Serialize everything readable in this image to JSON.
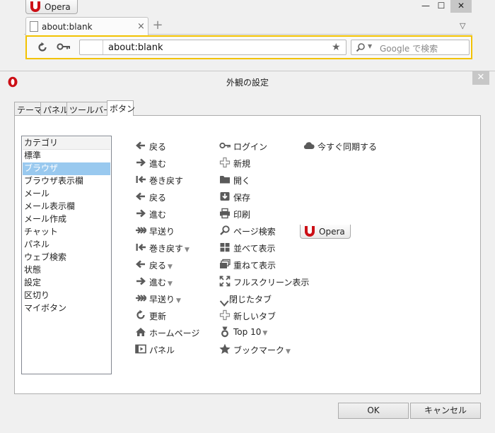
{
  "browser": {
    "menu_button_label": "Opera",
    "tab_title": "about:blank",
    "tab_close_glyph": "×",
    "new_tab_glyph": "+",
    "window_controls": [
      "—",
      "☐",
      "✕"
    ],
    "address_value": "about:blank",
    "search_placeholder": "Google で検索"
  },
  "dialog": {
    "title": "外観の設定",
    "close_glyph": "✕",
    "tabs": [
      {
        "label": "テーマ"
      },
      {
        "label": "パネル"
      },
      {
        "label": "ツールバー"
      },
      {
        "label": "ボタン",
        "active": true
      }
    ],
    "categories": [
      {
        "label": "カテゴリ",
        "header": true
      },
      {
        "label": "標準"
      },
      {
        "label": "ブラウザ",
        "selected": true
      },
      {
        "label": "ブラウザ表示欄"
      },
      {
        "label": "メール"
      },
      {
        "label": "メール表示欄"
      },
      {
        "label": "メール作成"
      },
      {
        "label": "チャット"
      },
      {
        "label": "パネル"
      },
      {
        "label": "ウェブ検索"
      },
      {
        "label": "状態"
      },
      {
        "label": "設定"
      },
      {
        "label": "区切り"
      },
      {
        "label": "マイボタン"
      }
    ],
    "buttons_col1": [
      {
        "label": "戻る",
        "icon": "arrow-left-icon"
      },
      {
        "label": "進む",
        "icon": "arrow-right-icon"
      },
      {
        "label": "巻き戻す",
        "icon": "rewind-icon"
      },
      {
        "label": "戻る",
        "icon": "arrow-left-icon"
      },
      {
        "label": "進む",
        "icon": "arrow-right-icon"
      },
      {
        "label": "早送り",
        "icon": "fast-forward-icon"
      },
      {
        "label": "巻き戻す",
        "icon": "rewind-icon",
        "dropdown": true
      },
      {
        "label": "戻る",
        "icon": "arrow-left-icon",
        "dropdown": true
      },
      {
        "label": "進む",
        "icon": "arrow-right-icon",
        "dropdown": true
      },
      {
        "label": "早送り",
        "icon": "fast-forward-icon",
        "dropdown": true
      },
      {
        "label": "更新",
        "icon": "reload-icon"
      },
      {
        "label": "ホームページ",
        "icon": "home-icon"
      },
      {
        "label": "パネル",
        "icon": "panel-icon"
      }
    ],
    "buttons_col2": [
      {
        "label": "ログイン",
        "icon": "key-icon"
      },
      {
        "label": "新規",
        "icon": "plus-icon"
      },
      {
        "label": "開く",
        "icon": "folder-icon"
      },
      {
        "label": "保存",
        "icon": "save-icon"
      },
      {
        "label": "印刷",
        "icon": "printer-icon"
      },
      {
        "label": "ページ検索",
        "icon": "magnifier-icon"
      },
      {
        "label": "並べて表示",
        "icon": "tile-icon"
      },
      {
        "label": "重ねて表示",
        "icon": "cascade-icon"
      },
      {
        "label": "フルスクリーン表示",
        "icon": "fullscreen-icon"
      },
      {
        "label": "閉じたタブ",
        "icon": "chevron-down-icon"
      },
      {
        "label": "新しいタブ",
        "icon": "plus-icon"
      },
      {
        "label": "Top 10",
        "icon": "medal-icon",
        "dropdown": true
      },
      {
        "label": "ブックマーク",
        "icon": "star-icon",
        "dropdown": true
      }
    ],
    "buttons_col3": [
      {
        "label": "今すぐ同期する",
        "icon": "cloud-icon"
      }
    ],
    "opera_button_label": "Opera",
    "ok_label": "OK",
    "cancel_label": "キャンセル"
  },
  "colors": {
    "accent_toolbar_border": "#f2c200",
    "selected_category": "#99c9ef",
    "opera_red": "#cc0f16",
    "icon_gray": "#5a5a5a"
  }
}
